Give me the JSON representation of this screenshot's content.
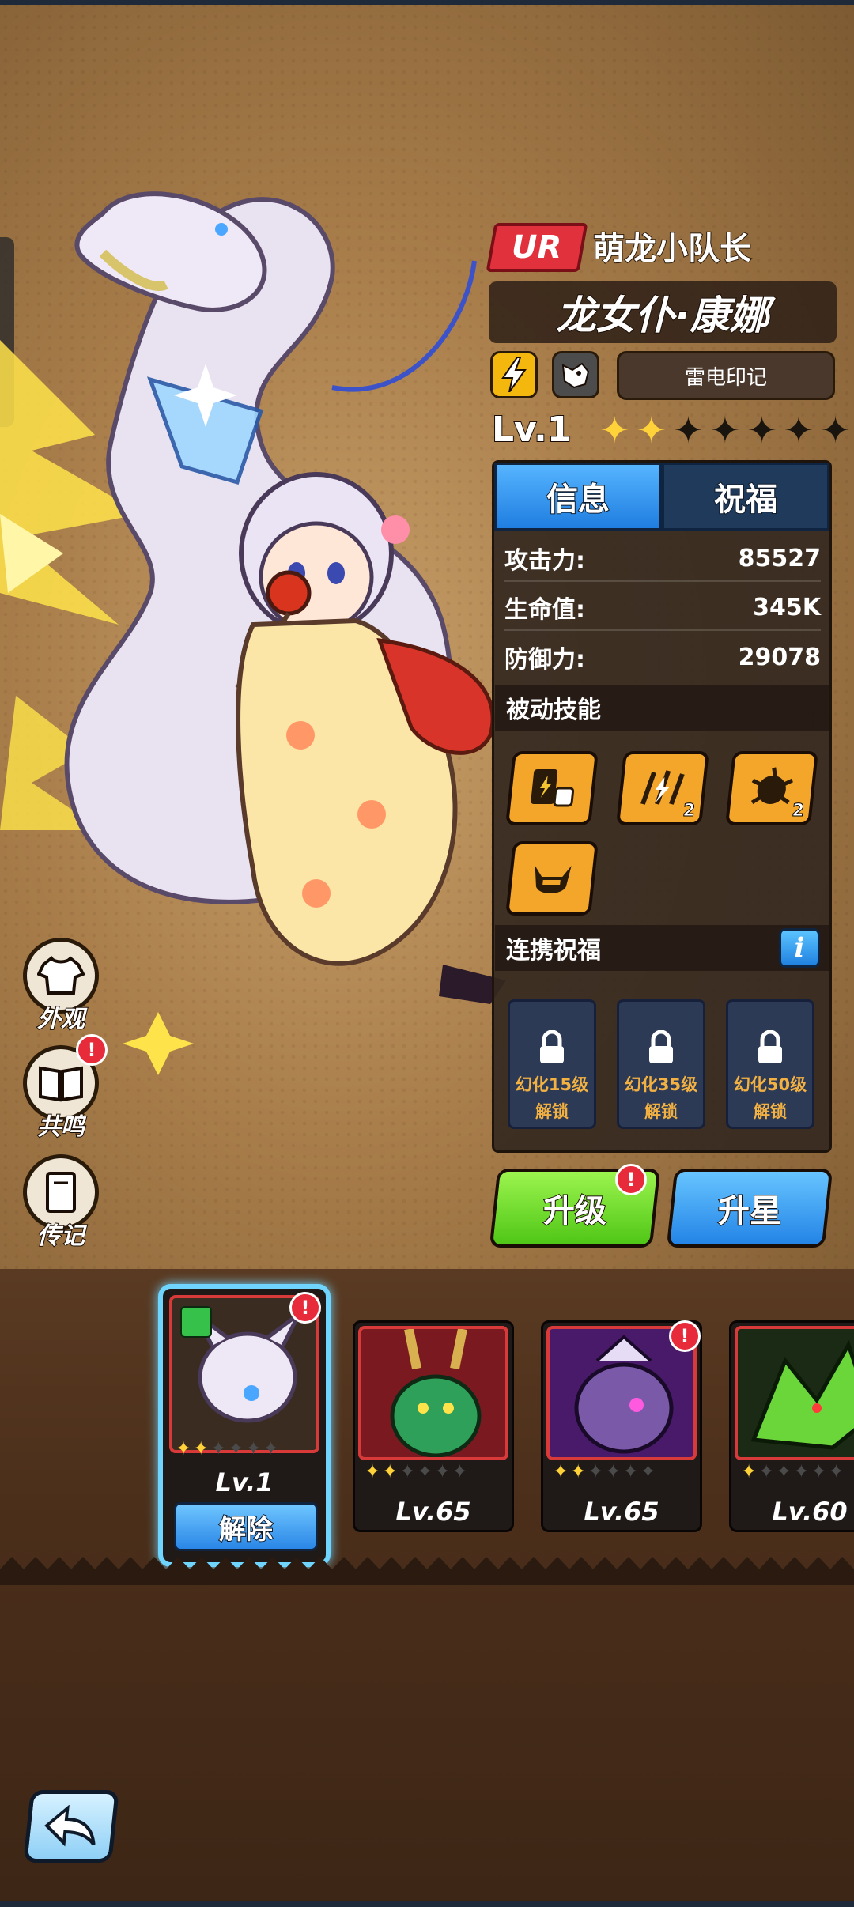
{
  "header": {
    "rarity": "UR",
    "team": "萌龙小队长",
    "name": "龙女仆·康娜",
    "mark": "雷电印记",
    "level": "Lv.1",
    "stars_filled": 2,
    "stars_total": 7
  },
  "tabs": [
    {
      "label": "信息",
      "active": true
    },
    {
      "label": "祝福",
      "active": false
    }
  ],
  "stats": [
    {
      "label": "攻击力:",
      "value": "85527"
    },
    {
      "label": "生命值:",
      "value": "345K"
    },
    {
      "label": "防御力:",
      "value": "29078"
    }
  ],
  "passive": {
    "title": "被动技能",
    "skills": [
      {
        "icon": "card-dice-icon",
        "count": ""
      },
      {
        "icon": "lightning-claw-icon",
        "count": "2"
      },
      {
        "icon": "orb-burst-icon",
        "count": "2"
      },
      {
        "icon": "horned-helmet-icon",
        "count": ""
      }
    ]
  },
  "bond": {
    "title": "连携祝福",
    "info": "i",
    "slots": [
      {
        "line1": "幻化15级",
        "line2": "解锁"
      },
      {
        "line1": "幻化35级",
        "line2": "解锁"
      },
      {
        "line1": "幻化50级",
        "line2": "解锁"
      }
    ]
  },
  "actions": {
    "upgrade": "升级",
    "upgrade_badge": "!",
    "star": "升星"
  },
  "side_menu": [
    {
      "label": "外观",
      "icon": "shirt-icon",
      "badge": ""
    },
    {
      "label": "共鸣",
      "icon": "book-icon",
      "badge": "!"
    },
    {
      "label": "传记",
      "icon": "journal-icon",
      "badge": ""
    }
  ],
  "roster": {
    "selected": {
      "level": "Lv.1",
      "stars": 2,
      "badge": "!",
      "release": "解除"
    },
    "cards": [
      {
        "level": "Lv.65",
        "stars": 2,
        "badge": "",
        "theme": "green-dragon"
      },
      {
        "level": "Lv.65",
        "stars": 2,
        "badge": "!",
        "theme": "purple-dragon"
      },
      {
        "level": "Lv.60",
        "stars": 1,
        "badge": "",
        "theme": "toxic-dragon"
      }
    ]
  },
  "colors": {
    "accent_gold": "#f3b70d",
    "rarity_red": "#e0313c",
    "tab_blue": "#2a86e6",
    "upgrade_green": "#4fc616"
  }
}
